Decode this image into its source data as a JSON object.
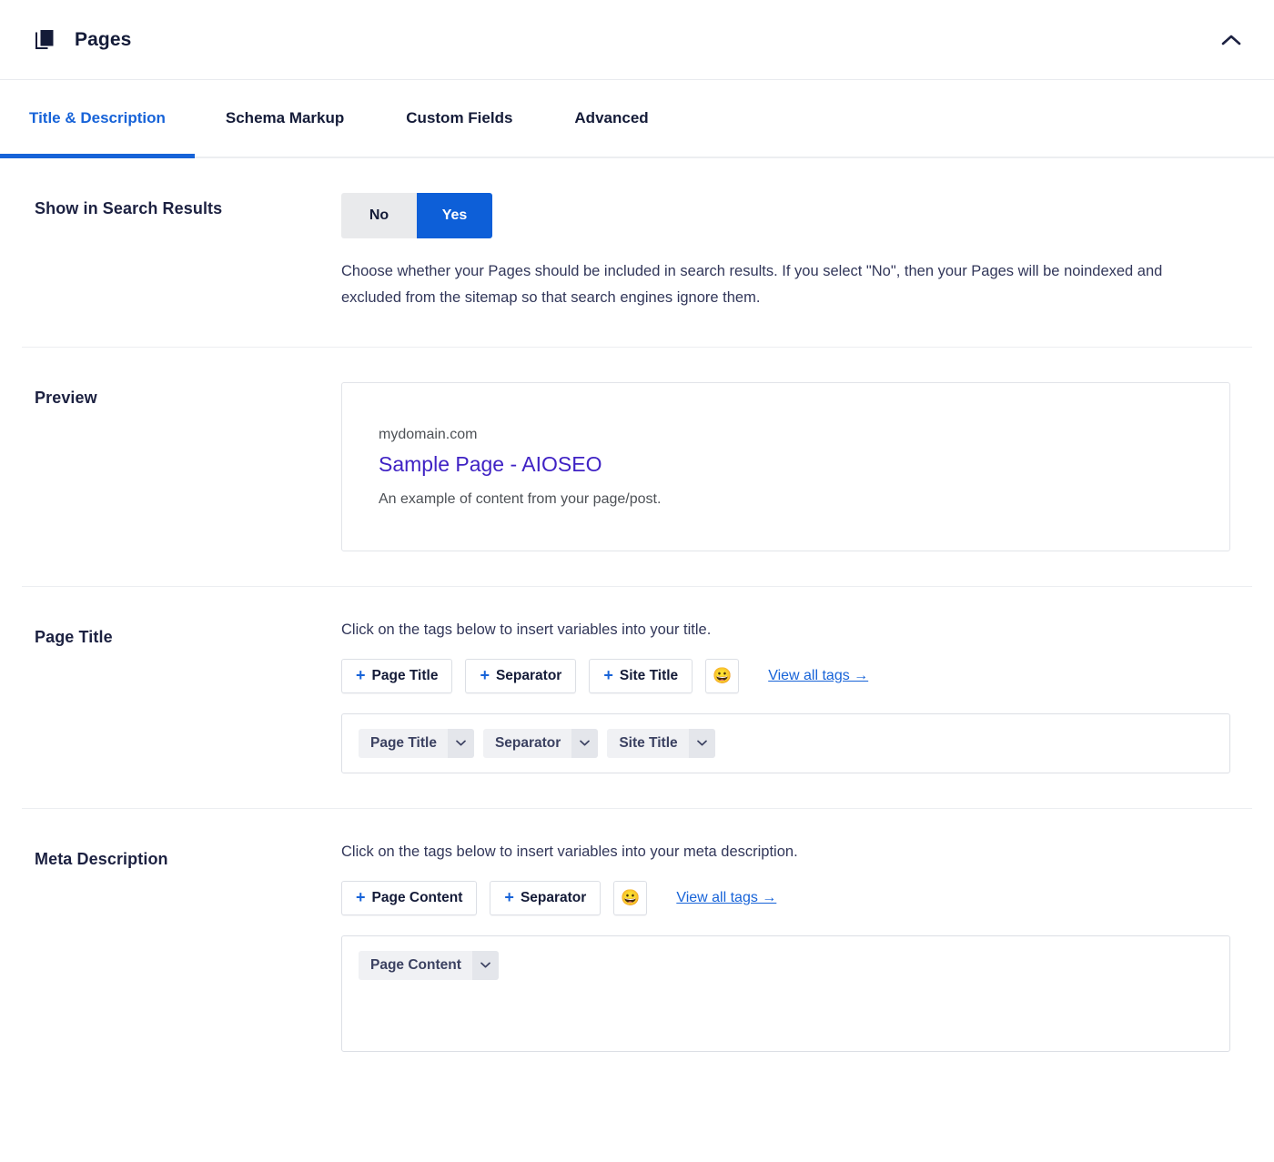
{
  "header": {
    "title": "Pages",
    "icon": "pages-stack-icon",
    "collapse_icon": "chevron-up-icon"
  },
  "tabs": [
    {
      "label": "Title & Description",
      "active": true
    },
    {
      "label": "Schema Markup",
      "active": false
    },
    {
      "label": "Custom Fields",
      "active": false
    },
    {
      "label": "Advanced",
      "active": false
    }
  ],
  "search_results": {
    "label": "Show in Search Results",
    "options": {
      "no": "No",
      "yes": "Yes"
    },
    "selected": "Yes",
    "description": "Choose whether your Pages should be included in search results. If you select \"No\", then your Pages will be noindexed and excluded from the sitemap so that search engines ignore them."
  },
  "preview": {
    "label": "Preview",
    "domain": "mydomain.com",
    "title": "Sample Page - AIOSEO",
    "description": "An example of content from your page/post."
  },
  "page_title": {
    "label": "Page Title",
    "hint": "Click on the tags below to insert variables into your title.",
    "tag_buttons": [
      {
        "plus": "+",
        "label": "Page Title"
      },
      {
        "plus": "+",
        "label": "Separator"
      },
      {
        "plus": "+",
        "label": "Site Title"
      }
    ],
    "emoji": "😀",
    "view_all": "View all tags →",
    "tokens": [
      "Page Title",
      "Separator",
      "Site Title"
    ]
  },
  "meta_description": {
    "label": "Meta Description",
    "hint": "Click on the tags below to insert variables into your meta description.",
    "tag_buttons": [
      {
        "plus": "+",
        "label": "Page Content"
      },
      {
        "plus": "+",
        "label": "Separator"
      }
    ],
    "emoji": "😀",
    "view_all": "View all tags →",
    "tokens": [
      "Page Content"
    ]
  },
  "colors": {
    "accent_blue": "#0d5fd8",
    "tab_blue": "#1763d8",
    "navy": "#141b38",
    "preview_link": "#3f22c4",
    "toggle_off_bg": "#e9eaec"
  }
}
